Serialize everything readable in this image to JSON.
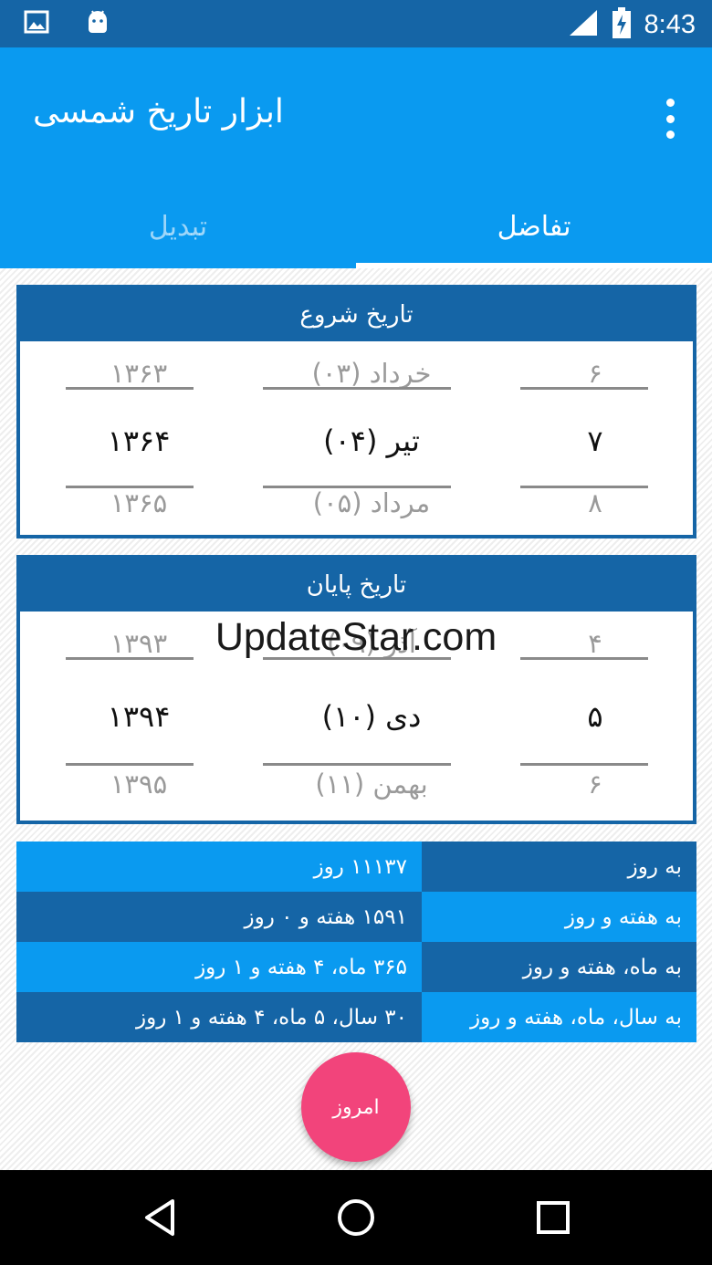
{
  "status_bar": {
    "time": "8:43",
    "icons": [
      "image-icon",
      "android-icon",
      "signal-icon",
      "battery-charging-icon"
    ]
  },
  "app_bar": {
    "title": "ابزار تاریخ شمسی",
    "menu_icon": "more-vert-icon"
  },
  "tabs": [
    {
      "label": "تبدیل",
      "active": false
    },
    {
      "label": "تفاضل",
      "active": true
    }
  ],
  "start_date": {
    "header": "تاریخ شروع",
    "year": {
      "prev": "۱۳۶۳",
      "current": "۱۳۶۴",
      "next": "۱۳۶۵"
    },
    "month": {
      "prev": "خرداد (۰۳)",
      "current": "تیر (۰۴)",
      "next": "مرداد (۰۵)"
    },
    "day": {
      "prev": "۶",
      "current": "۷",
      "next": "۸"
    }
  },
  "end_date": {
    "header": "تاریخ پایان",
    "year": {
      "prev": "۱۳۹۳",
      "current": "۱۳۹۴",
      "next": "۱۳۹۵"
    },
    "month": {
      "prev": "آذر (۰۹)",
      "current": "دی (۱۰)",
      "next": "بهمن (۱۱)"
    },
    "day": {
      "prev": "۴",
      "current": "۵",
      "next": "۶"
    }
  },
  "watermark": "UpdateStar.com",
  "results": [
    {
      "label": "به روز",
      "value": "۱۱۱۳۷ روز"
    },
    {
      "label": "به هفته و روز",
      "value": "۱۵۹۱ هفته و ۰ روز"
    },
    {
      "label": "به ماه، هفته و روز",
      "value": "۳۶۵ ماه، ۴ هفته و ۱ روز"
    },
    {
      "label": "به سال، ماه، هفته و روز",
      "value": "۳۰ سال، ۵ ماه، ۴ هفته و ۱ روز"
    }
  ],
  "fab": {
    "label": "امروز"
  },
  "nav_bar": {
    "icons": [
      "back-icon",
      "home-icon",
      "recents-icon"
    ]
  },
  "colors": {
    "primary_dark": "#1565a6",
    "primary": "#0a9af0",
    "accent": "#f2447b"
  }
}
